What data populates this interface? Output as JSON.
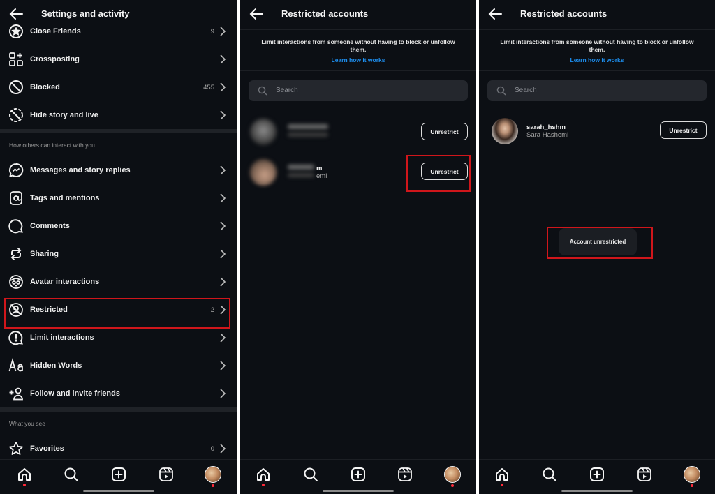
{
  "panels": [
    {
      "title": "Settings and activity",
      "items_top": [
        {
          "label": "Close Friends",
          "count": "9",
          "icon": "star-circle-icon"
        },
        {
          "label": "Crossposting",
          "count": "",
          "icon": "grid-plus-icon"
        },
        {
          "label": "Blocked",
          "count": "455",
          "icon": "block-icon"
        },
        {
          "label": "Hide story and live",
          "count": "",
          "icon": "hide-story-icon"
        }
      ],
      "section_interact": "How others can interact with you",
      "items_interact": [
        {
          "label": "Messages and story replies",
          "count": "",
          "icon": "messenger-icon"
        },
        {
          "label": "Tags and mentions",
          "count": "",
          "icon": "at-sign-icon"
        },
        {
          "label": "Comments",
          "count": "",
          "icon": "comment-icon"
        },
        {
          "label": "Sharing",
          "count": "",
          "icon": "share-repost-icon"
        },
        {
          "label": "Avatar interactions",
          "count": "",
          "icon": "avatar-face-icon"
        },
        {
          "label": "Restricted",
          "count": "2",
          "icon": "restricted-icon"
        },
        {
          "label": "Limit interactions",
          "count": "",
          "icon": "limit-alert-icon"
        },
        {
          "label": "Hidden Words",
          "count": "",
          "icon": "text-aa-icon"
        },
        {
          "label": "Follow and invite friends",
          "count": "",
          "icon": "add-person-icon"
        }
      ],
      "section_see": "What you see",
      "items_see": [
        {
          "label": "Favorites",
          "count": "0",
          "icon": "star-icon"
        }
      ],
      "highlighted_item": "Restricted"
    },
    {
      "title": "Restricted accounts",
      "description": "Limit interactions from someone without having to block or unfollow them.",
      "learn_link": "Learn how it works",
      "search_placeholder": "Search",
      "accounts": [
        {
          "username": "",
          "fullname": "",
          "blurred": true,
          "button": "Unrestrict"
        },
        {
          "username": "m",
          "fullname": "emi",
          "blurred": true,
          "button": "Unrestrict"
        }
      ],
      "highlighted_button_index": 1
    },
    {
      "title": "Restricted accounts",
      "description": "Limit interactions from someone without having to block or unfollow them.",
      "learn_link": "Learn how it works",
      "search_placeholder": "Search",
      "accounts": [
        {
          "username": "sarah_hshm",
          "fullname": "Sara Hashemi",
          "blurred": false,
          "button": "Unrestrict"
        }
      ],
      "toast": "Account unrestricted"
    }
  ],
  "bottom_nav": [
    {
      "name": "home",
      "icon": "home-icon",
      "notification_dot": true
    },
    {
      "name": "search",
      "icon": "search-icon",
      "notification_dot": false
    },
    {
      "name": "create",
      "icon": "plus-square-icon",
      "notification_dot": false
    },
    {
      "name": "reels",
      "icon": "reels-icon",
      "notification_dot": false
    },
    {
      "name": "profile",
      "icon": "profile-avatar",
      "notification_dot": true
    }
  ],
  "colors": {
    "background": "#0c0f14",
    "link": "#1d8ff0",
    "highlight": "#d0161b",
    "notification": "#ff2a3a"
  }
}
